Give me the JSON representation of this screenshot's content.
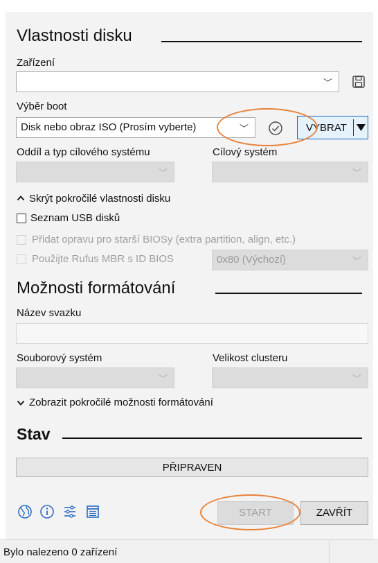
{
  "drive_props": {
    "heading": "Vlastnosti disku",
    "device_label": "Zařízení",
    "device_value": "",
    "boot_label": "Výběr boot",
    "boot_value": "Disk nebo obraz ISO (Prosím vyberte)",
    "select_label": "VYBRAT",
    "partition_label": "Oddíl a typ cílového systému",
    "partition_value": "",
    "target_label": "Cílový systém",
    "target_value": "",
    "advanced_toggle": "Skrýt pokročilé vlastnosti disku",
    "list_usb": "Seznam USB disků",
    "add_fix": "Přidat opravu pro starší BIOSy (extra partition, align, etc.)",
    "use_mbr": "Použijte Rufus MBR s ID BIOS",
    "bios_id_value": "0x80 (Výchozí)"
  },
  "format_opts": {
    "heading": "Možnosti formátování",
    "volume_label": "Název svazku",
    "volume_value": "",
    "fs_label": "Souborový systém",
    "fs_value": "",
    "cluster_label": "Velikost clusteru",
    "cluster_value": "",
    "advanced_toggle": "Zobrazit pokročilé možnosti formátování"
  },
  "status": {
    "heading": "Stav",
    "progress_text": "PŘIPRAVEN",
    "progress": 0
  },
  "buttons": {
    "start": "START",
    "close": "ZAVŘÍT"
  },
  "statusbar": {
    "text": "Bylo nalezeno 0 zařízení"
  },
  "icons": [
    "globe-icon",
    "info-icon",
    "settings-icon",
    "log-icon",
    "save-icon",
    "check-icon"
  ],
  "colors": {
    "accent": "#0a64c8",
    "annotation": "#e8823a"
  }
}
